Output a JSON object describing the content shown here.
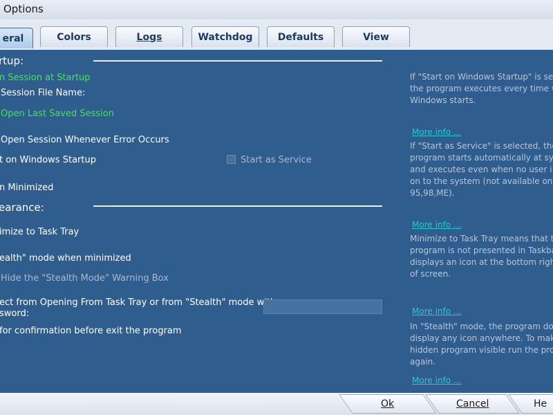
{
  "window": {
    "title": "Options"
  },
  "tabs": [
    {
      "label": "eral"
    },
    {
      "label": "Colors"
    },
    {
      "label": "Logs"
    },
    {
      "label": "Watchdog"
    },
    {
      "label": "Defaults"
    },
    {
      "label": "View"
    }
  ],
  "startup": {
    "section_label": "rtup:",
    "open_session_at_startup": "n Session at Startup",
    "session_file_name_label": "Session File Name:",
    "open_last_saved_session": "Open Last Saved Session",
    "open_session_on_error": "Open Session Whenever Error Occurs",
    "start_on_windows_startup": "t on Windows Startup",
    "start_as_service": "Start as Service",
    "start_minimized": "n Minimized"
  },
  "appearance": {
    "section_label": "earance:",
    "minimize_to_tray": "imize to Task Tray",
    "stealth_mode": "ealth\" mode when minimized",
    "hide_stealth_warning": "Hide the \"Stealth Mode\" Warning Box",
    "protect_line1": "ect from Opening From Task Tray or from \"Stealth\" mode with",
    "protect_line2": "sword:",
    "password_value": "",
    "confirm_exit": "for confirmation before exit the program"
  },
  "help": {
    "block1": [
      "If \"Start on Windows Startup\" is se",
      "the program executes every time w",
      "Windows starts."
    ],
    "link1": "More info ...",
    "block2": [
      "If \"Start as Service\" is selected, the",
      "program starts automatically at sys",
      "and executes even when no user i",
      "on to the system (not available on W",
      "95,98,ME)."
    ],
    "link2": "More info ...",
    "block3": [
      "Minimize to Task Tray means that th",
      "program is not presented in Taskba",
      "displays an icon at the bottom right",
      "of screen."
    ],
    "link3": "More info ...",
    "block4": [
      "In \"Stealth\" mode, the program does",
      "display any icon anywhere. To mak",
      "hidden program visible run the prog",
      "again."
    ],
    "link4": "More info ..."
  },
  "buttons": {
    "ok": "Ok",
    "cancel": "Cancel",
    "help": "He"
  },
  "colors": {
    "panel_bg": "#2f5d8e",
    "highlight_text": "#3fe84f",
    "link": "#29c8d6"
  }
}
